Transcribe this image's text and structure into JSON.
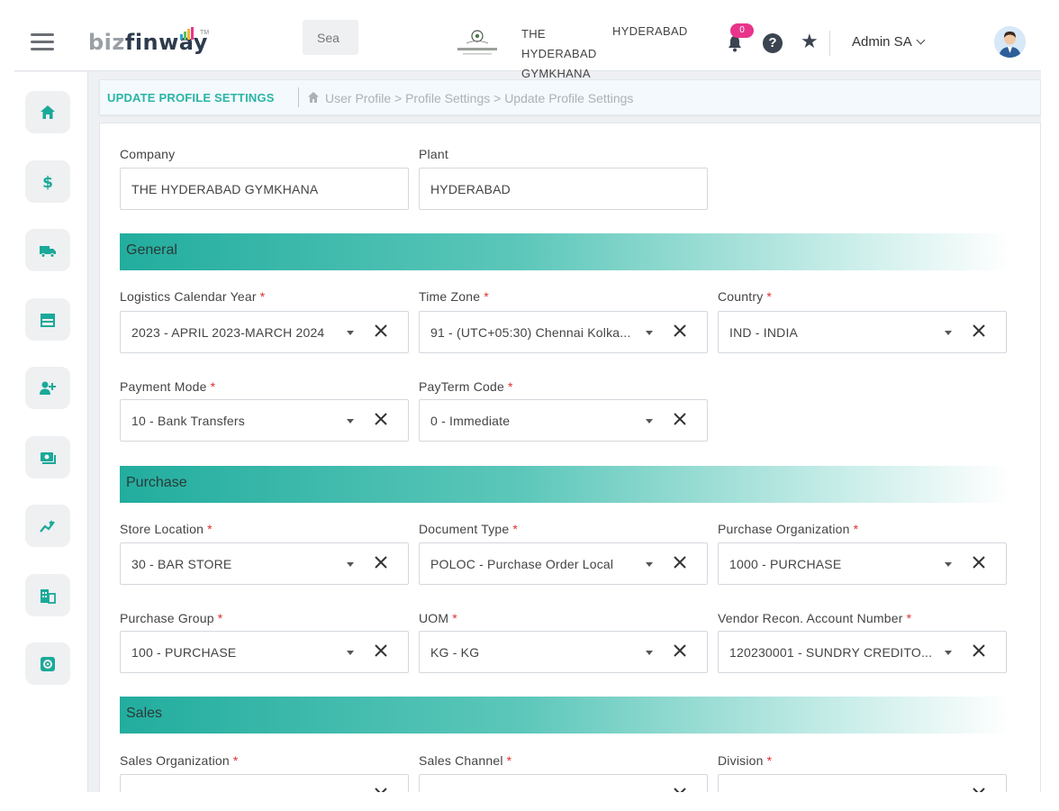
{
  "header": {
    "logo_biz": "biz",
    "logo_finway": "finway",
    "logo_tm": "TM",
    "search_placeholder": "Sea",
    "club_name": "THE HYDERABAD GYMKHANA",
    "plant_name": "HYDERABAD",
    "notification_count": "0",
    "user_name": "Admin SA"
  },
  "breadcrumb": {
    "title": "UPDATE PROFILE SETTINGS",
    "path": "User Profile > Profile Settings > Update Profile Settings"
  },
  "sidebar": {
    "items": [
      "home-icon",
      "dollar-icon",
      "truck-icon",
      "store-icon",
      "user-plus-icon",
      "money-icon",
      "chart-icon",
      "building-icon",
      "gear-icon"
    ]
  },
  "form": {
    "company": {
      "label": "Company",
      "value": "THE HYDERABAD GYMKHANA"
    },
    "plant": {
      "label": "Plant",
      "value": "HYDERABAD"
    },
    "sections": {
      "general": "General",
      "purchase": "Purchase",
      "sales": "Sales"
    },
    "general": {
      "logistics_year": {
        "label": "Logistics Calendar Year",
        "value": "2023 - APRIL 2023-MARCH 2024"
      },
      "time_zone": {
        "label": "Time Zone",
        "value": "91 - (UTC+05:30) Chennai Kolka..."
      },
      "country": {
        "label": "Country",
        "value": "IND - INDIA"
      },
      "payment_mode": {
        "label": "Payment Mode",
        "value": "10 - Bank Transfers"
      },
      "payterm_code": {
        "label": "PayTerm Code",
        "value": "0 - Immediate"
      }
    },
    "purchase": {
      "store_location": {
        "label": "Store Location",
        "value": "30 - BAR STORE"
      },
      "document_type": {
        "label": "Document Type",
        "value": "POLOC - Purchase Order Local"
      },
      "purchase_org": {
        "label": "Purchase Organization",
        "value": "1000 - PURCHASE"
      },
      "purchase_group": {
        "label": "Purchase Group",
        "value": "100 - PURCHASE"
      },
      "uom": {
        "label": "UOM",
        "value": "KG - KG"
      },
      "vendor_recon": {
        "label": "Vendor Recon. Account Number",
        "value": "120230001 - SUNDRY CREDITO..."
      }
    },
    "sales": {
      "sales_org": {
        "label": "Sales Organization",
        "value": ""
      },
      "sales_channel": {
        "label": "Sales Channel",
        "value": ""
      },
      "division": {
        "label": "Division",
        "value": ""
      }
    },
    "required_mark": "*"
  },
  "colors": {
    "accent": "#2ab5a6",
    "section_gradient_start": "#22ad9e",
    "required": "#e0302f",
    "badge": "#e8358b"
  }
}
